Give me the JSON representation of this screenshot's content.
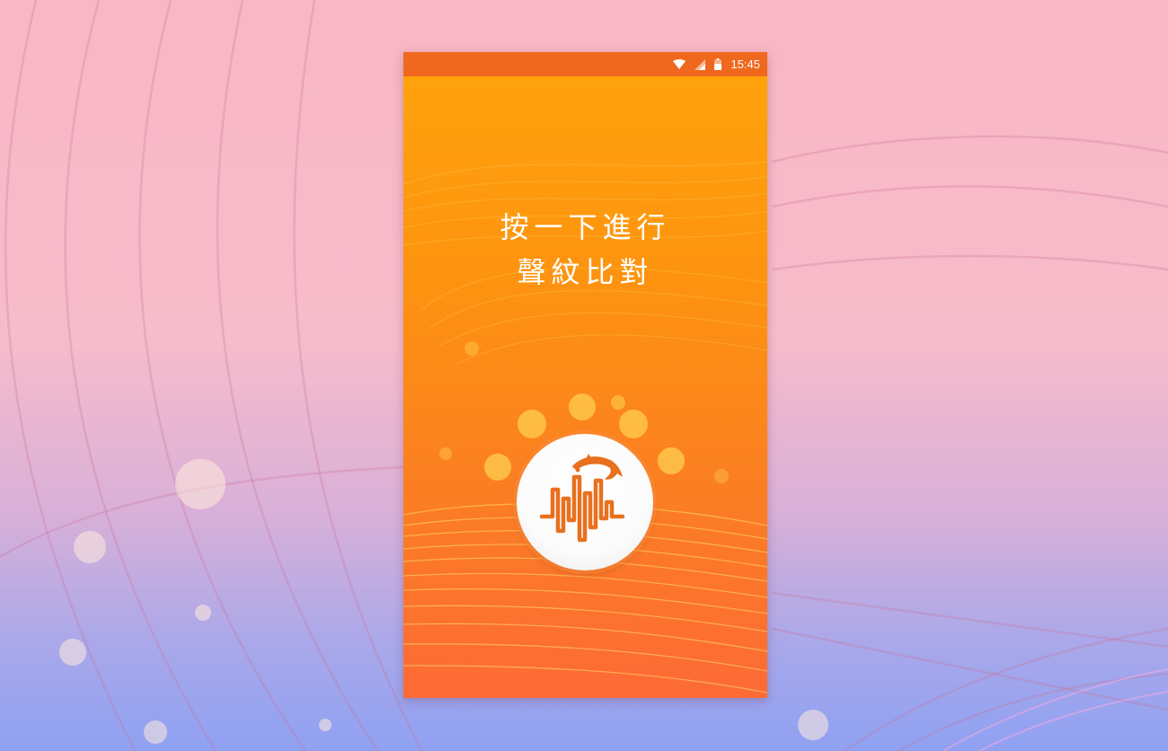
{
  "status_bar": {
    "time": "15:45",
    "icons": [
      "wifi-icon",
      "signal-icon",
      "battery-icon"
    ]
  },
  "prompt": {
    "line1": "按一下進行",
    "line2": "聲紋比對"
  },
  "action_button": {
    "icon": "dolphin-soundwave-icon"
  },
  "colors": {
    "status_bar": "#f0681d",
    "screen_top": "#ffa40c",
    "screen_bottom": "#fd6a36",
    "icon_stroke": "#e8701e",
    "page_background_top": "#f9b6c4",
    "page_background_bottom": "#8fa1f2"
  }
}
